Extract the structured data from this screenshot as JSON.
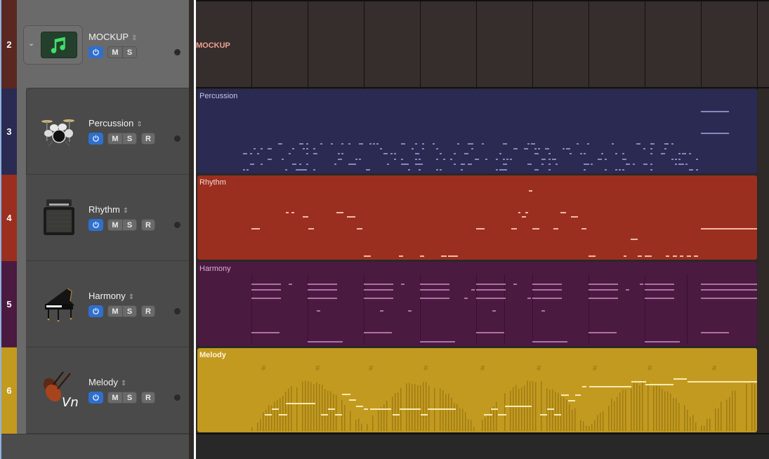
{
  "folder": {
    "number": "2",
    "name": "MOCKUP",
    "region_label": "MOCKUP",
    "icon": "music-note-icon",
    "strip_color": "#5a2820",
    "buttons": {
      "power": "power-icon",
      "mute": "M",
      "solo": "S"
    }
  },
  "tracks": [
    {
      "number": "3",
      "name": "Percussion",
      "icon": "drum-kit-icon",
      "color": "#2a2a52",
      "note_color": "#8888c0",
      "title_color": "#c8c8e8",
      "mute": "M",
      "solo": "S",
      "record": "R"
    },
    {
      "number": "4",
      "name": "Rhythm",
      "icon": "amplifier-icon",
      "color": "#9a2f1f",
      "note_color": "#f5b8a8",
      "title_color": "#f8d8d0",
      "mute": "M",
      "solo": "S",
      "record": "R"
    },
    {
      "number": "5",
      "name": "Harmony",
      "icon": "grand-piano-icon",
      "color": "#4b1a40",
      "note_color": "#b070a8",
      "title_color": "#d8b0d0",
      "mute": "M",
      "solo": "S",
      "record": "R"
    },
    {
      "number": "6",
      "name": "Melody",
      "icon": "violin-icon",
      "color": "#c39a20",
      "note_color": "#fbeab0",
      "title_color": "#fdf4d8",
      "mute": "M",
      "solo": "S",
      "record": "R",
      "icon_text": "Vn",
      "marker_glyph": "#"
    }
  ],
  "colors": {
    "accent_power": "#2f6fce",
    "header_bg": "#4a4a4a",
    "folder_lane_bg": "#352e2c"
  }
}
